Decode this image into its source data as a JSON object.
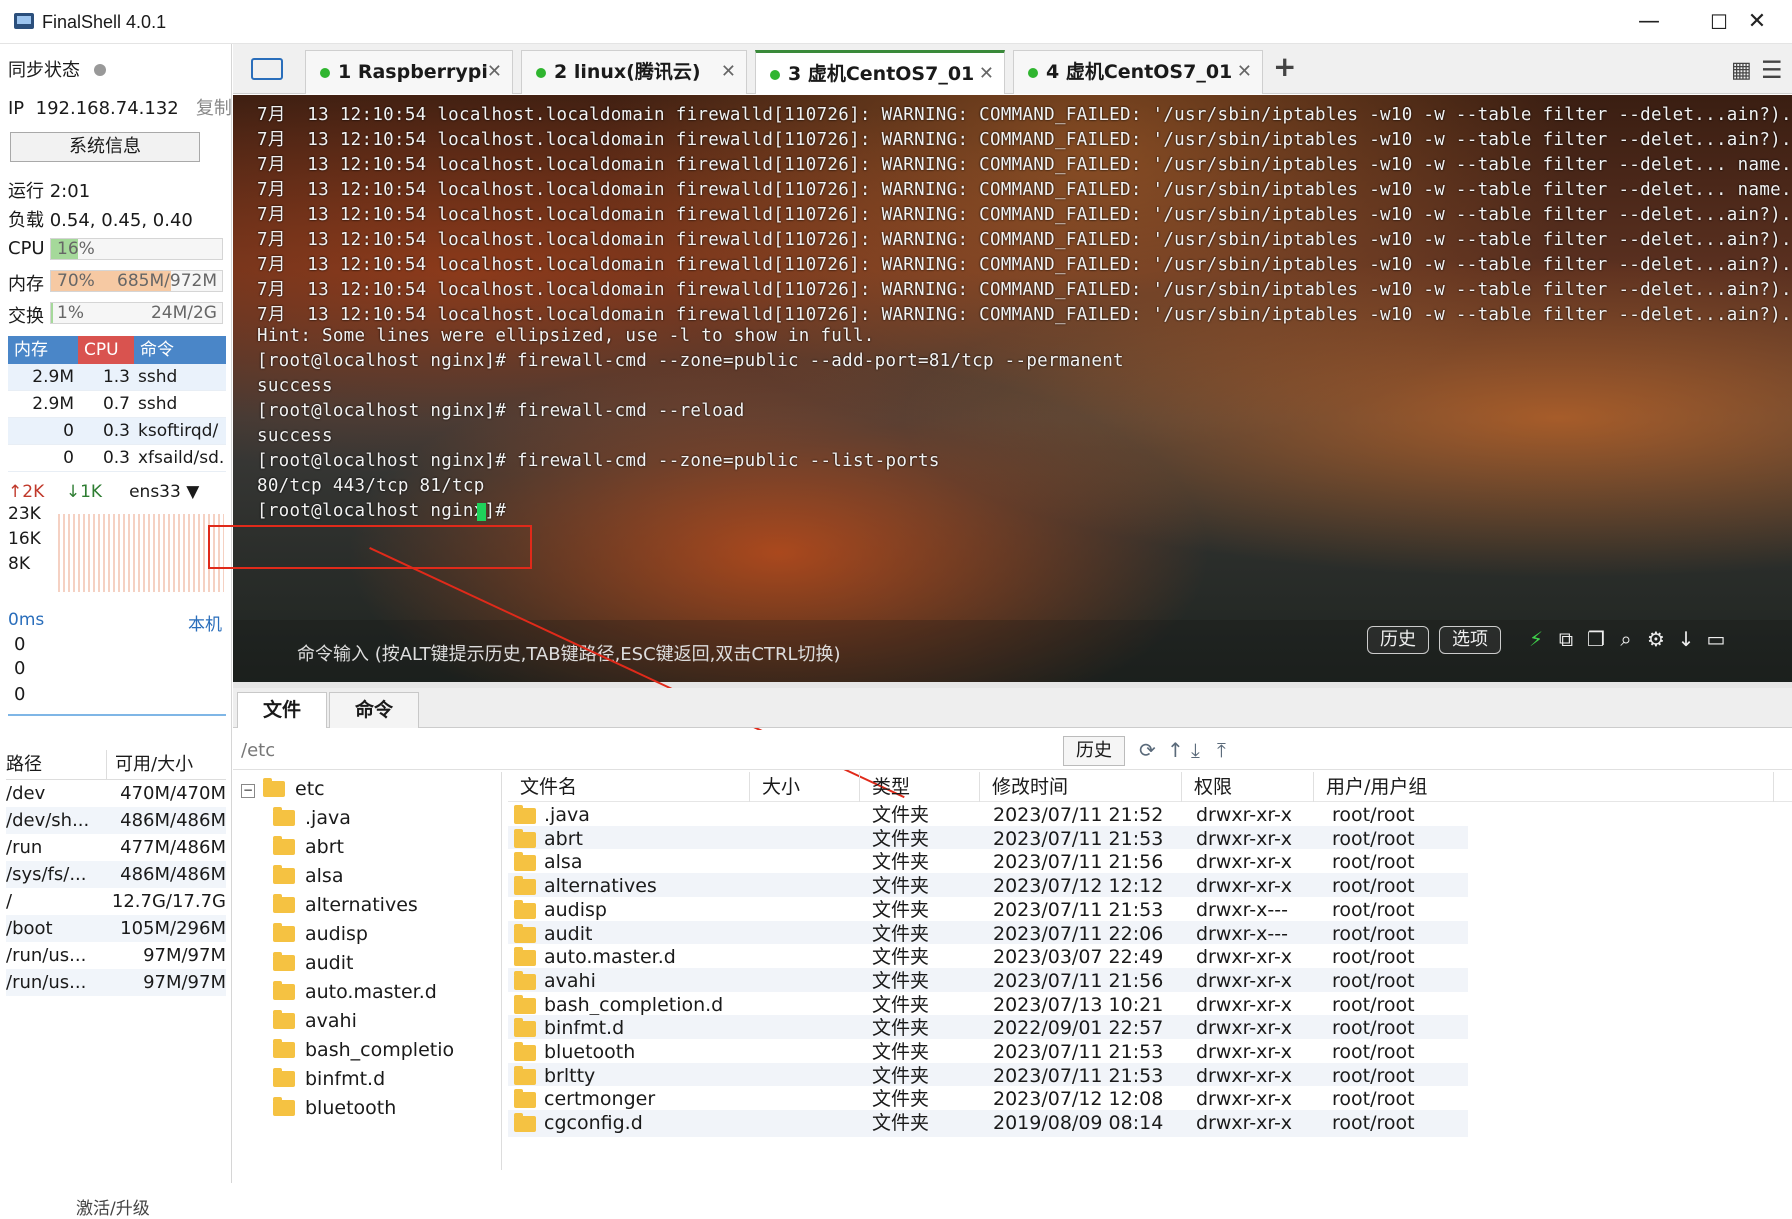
{
  "window": {
    "title": "FinalShell 4.0.1",
    "minimize": "—",
    "maximize": "☐",
    "close": "✕"
  },
  "sidebar": {
    "sync_label": "同步状态",
    "ip_label": "IP",
    "ip_value": "192.168.74.132",
    "copy_label": "复制",
    "sysinfo_button": "系统信息",
    "uptime": "运行 2:01",
    "load": "负载 0.54, 0.45, 0.40",
    "cpu": {
      "label": "CPU",
      "text": "16%",
      "percent": 16
    },
    "mem": {
      "label": "内存",
      "text": "70%",
      "right": "685M/972M",
      "percent": 70
    },
    "swap": {
      "label": "交换",
      "text": "1%",
      "right": "24M/2G",
      "percent": 1
    },
    "proc_headers": [
      "内存",
      "CPU",
      "命令"
    ],
    "processes": [
      {
        "mem": "2.9M",
        "cpu": "1.3",
        "cmd": "sshd"
      },
      {
        "mem": "2.9M",
        "cpu": "0.7",
        "cmd": "sshd"
      },
      {
        "mem": "0",
        "cpu": "0.3",
        "cmd": "ksoftirqd/"
      },
      {
        "mem": "0",
        "cpu": "0.3",
        "cmd": "xfsaild/sd."
      }
    ],
    "net": {
      "up": "2K",
      "down": "1K",
      "iface": "ens33",
      "scale": [
        "23K",
        "16K",
        "8K"
      ]
    },
    "ping": {
      "label": "0ms",
      "target": "本机",
      "values": [
        "0",
        "0",
        "0"
      ]
    },
    "disk_headers": [
      "路径",
      "可用/大小"
    ],
    "disks": [
      {
        "path": "/dev",
        "size": "470M/470M"
      },
      {
        "path": "/dev/sh...",
        "size": "486M/486M"
      },
      {
        "path": "/run",
        "size": "477M/486M"
      },
      {
        "path": "/sys/fs/...",
        "size": "486M/486M"
      },
      {
        "path": "/",
        "size": "12.7G/17.7G"
      },
      {
        "path": "/boot",
        "size": "105M/296M"
      },
      {
        "path": "/run/us...",
        "size": "97M/97M"
      },
      {
        "path": "/run/us...",
        "size": "97M/97M"
      }
    ],
    "activate": "激活/升级"
  },
  "tabs": [
    {
      "label": "1 Raspberrypi"
    },
    {
      "label": "2 linux(腾讯云)"
    },
    {
      "label": "3 虚机CentOS7_01"
    },
    {
      "label": "4 虚机CentOS7_01"
    }
  ],
  "add_tab": "+",
  "terminal": {
    "lines": [
      "7月  13 12:10:54 localhost.localdomain firewalld[110726]: WARNING: COMMAND_FAILED: '/usr/sbin/iptables -w10 -w --table filter --delet...ain?).",
      "7月  13 12:10:54 localhost.localdomain firewalld[110726]: WARNING: COMMAND_FAILED: '/usr/sbin/iptables -w10 -w --table filter --delet...ain?).",
      "7月  13 12:10:54 localhost.localdomain firewalld[110726]: WARNING: COMMAND_FAILED: '/usr/sbin/iptables -w10 -w --table filter --delet... name.",
      "7月  13 12:10:54 localhost.localdomain firewalld[110726]: WARNING: COMMAND_FAILED: '/usr/sbin/iptables -w10 -w --table filter --delet... name.",
      "7月  13 12:10:54 localhost.localdomain firewalld[110726]: WARNING: COMMAND_FAILED: '/usr/sbin/iptables -w10 -w --table filter --delet...ain?).",
      "7月  13 12:10:54 localhost.localdomain firewalld[110726]: WARNING: COMMAND_FAILED: '/usr/sbin/iptables -w10 -w --table filter --delet...ain?).",
      "7月  13 12:10:54 localhost.localdomain firewalld[110726]: WARNING: COMMAND_FAILED: '/usr/sbin/iptables -w10 -w --table filter --delet...ain?).",
      "7月  13 12:10:54 localhost.localdomain firewalld[110726]: WARNING: COMMAND_FAILED: '/usr/sbin/iptables -w10 -w --table filter --delet...ain?).",
      "7月  13 12:10:54 localhost.localdomain firewalld[110726]: WARNING: COMMAND_FAILED: '/usr/sbin/iptables -w10 -w --table filter --delet...ain?).",
      "Hint: Some lines were ellipsized, use -l to show in full.",
      "[root@localhost nginx]# firewall-cmd --zone=public --add-port=81/tcp --permanent",
      "success",
      "[root@localhost nginx]# firewall-cmd --reload",
      "success",
      "[root@localhost nginx]# firewall-cmd --zone=public --list-ports",
      "80/tcp 443/tcp 81/tcp",
      "[root@localhost nginx]# "
    ],
    "cmd_placeholder": "命令输入 (按ALT键提示历史,TAB键路径,ESC键返回,双击CTRL切换)",
    "history_button": "历史",
    "options_button": "选项"
  },
  "bottom_tabs": [
    "文件",
    "命令"
  ],
  "path": "/etc",
  "path_history": "历史",
  "tree": [
    "etc",
    ".java",
    "abrt",
    "alsa",
    "alternatives",
    "audisp",
    "audit",
    "auto.master.d",
    "avahi",
    "bash_completio",
    "binfmt.d",
    "bluetooth"
  ],
  "file_headers": [
    "文件名",
    "大小",
    "类型",
    "修改时间",
    "权限",
    "用户/用户组"
  ],
  "files": [
    {
      "name": ".java",
      "type": "文件夹",
      "mtime": "2023/07/11 21:52",
      "perm": "drwxr-xr-x",
      "owner": "root/root"
    },
    {
      "name": "abrt",
      "type": "文件夹",
      "mtime": "2023/07/11 21:53",
      "perm": "drwxr-xr-x",
      "owner": "root/root"
    },
    {
      "name": "alsa",
      "type": "文件夹",
      "mtime": "2023/07/11 21:56",
      "perm": "drwxr-xr-x",
      "owner": "root/root"
    },
    {
      "name": "alternatives",
      "type": "文件夹",
      "mtime": "2023/07/12 12:12",
      "perm": "drwxr-xr-x",
      "owner": "root/root"
    },
    {
      "name": "audisp",
      "type": "文件夹",
      "mtime": "2023/07/11 21:53",
      "perm": "drwxr-x---",
      "owner": "root/root"
    },
    {
      "name": "audit",
      "type": "文件夹",
      "mtime": "2023/07/11 22:06",
      "perm": "drwxr-x---",
      "owner": "root/root"
    },
    {
      "name": "auto.master.d",
      "type": "文件夹",
      "mtime": "2023/03/07 22:49",
      "perm": "drwxr-xr-x",
      "owner": "root/root"
    },
    {
      "name": "avahi",
      "type": "文件夹",
      "mtime": "2023/07/11 21:56",
      "perm": "drwxr-xr-x",
      "owner": "root/root"
    },
    {
      "name": "bash_completion.d",
      "type": "文件夹",
      "mtime": "2023/07/13 10:21",
      "perm": "drwxr-xr-x",
      "owner": "root/root"
    },
    {
      "name": "binfmt.d",
      "type": "文件夹",
      "mtime": "2022/09/01 22:57",
      "perm": "drwxr-xr-x",
      "owner": "root/root"
    },
    {
      "name": "bluetooth",
      "type": "文件夹",
      "mtime": "2023/07/11 21:53",
      "perm": "drwxr-xr-x",
      "owner": "root/root"
    },
    {
      "name": "brltty",
      "type": "文件夹",
      "mtime": "2023/07/11 21:53",
      "perm": "drwxr-xr-x",
      "owner": "root/root"
    },
    {
      "name": "certmonger",
      "type": "文件夹",
      "mtime": "2023/07/12 12:08",
      "perm": "drwxr-xr-x",
      "owner": "root/root"
    },
    {
      "name": "cgconfig.d",
      "type": "文件夹",
      "mtime": "2019/08/09 08:14",
      "perm": "drwxr-xr-x",
      "owner": "root/root"
    }
  ],
  "colors": {
    "accent_green": "#2fb52f",
    "annotation_red": "#e02a1a",
    "cpu_fill": "#a5d99a",
    "mem_fill": "#f6c9a3",
    "proc_header_blue": "#4a86c8",
    "proc_header_red": "#d9534f"
  }
}
